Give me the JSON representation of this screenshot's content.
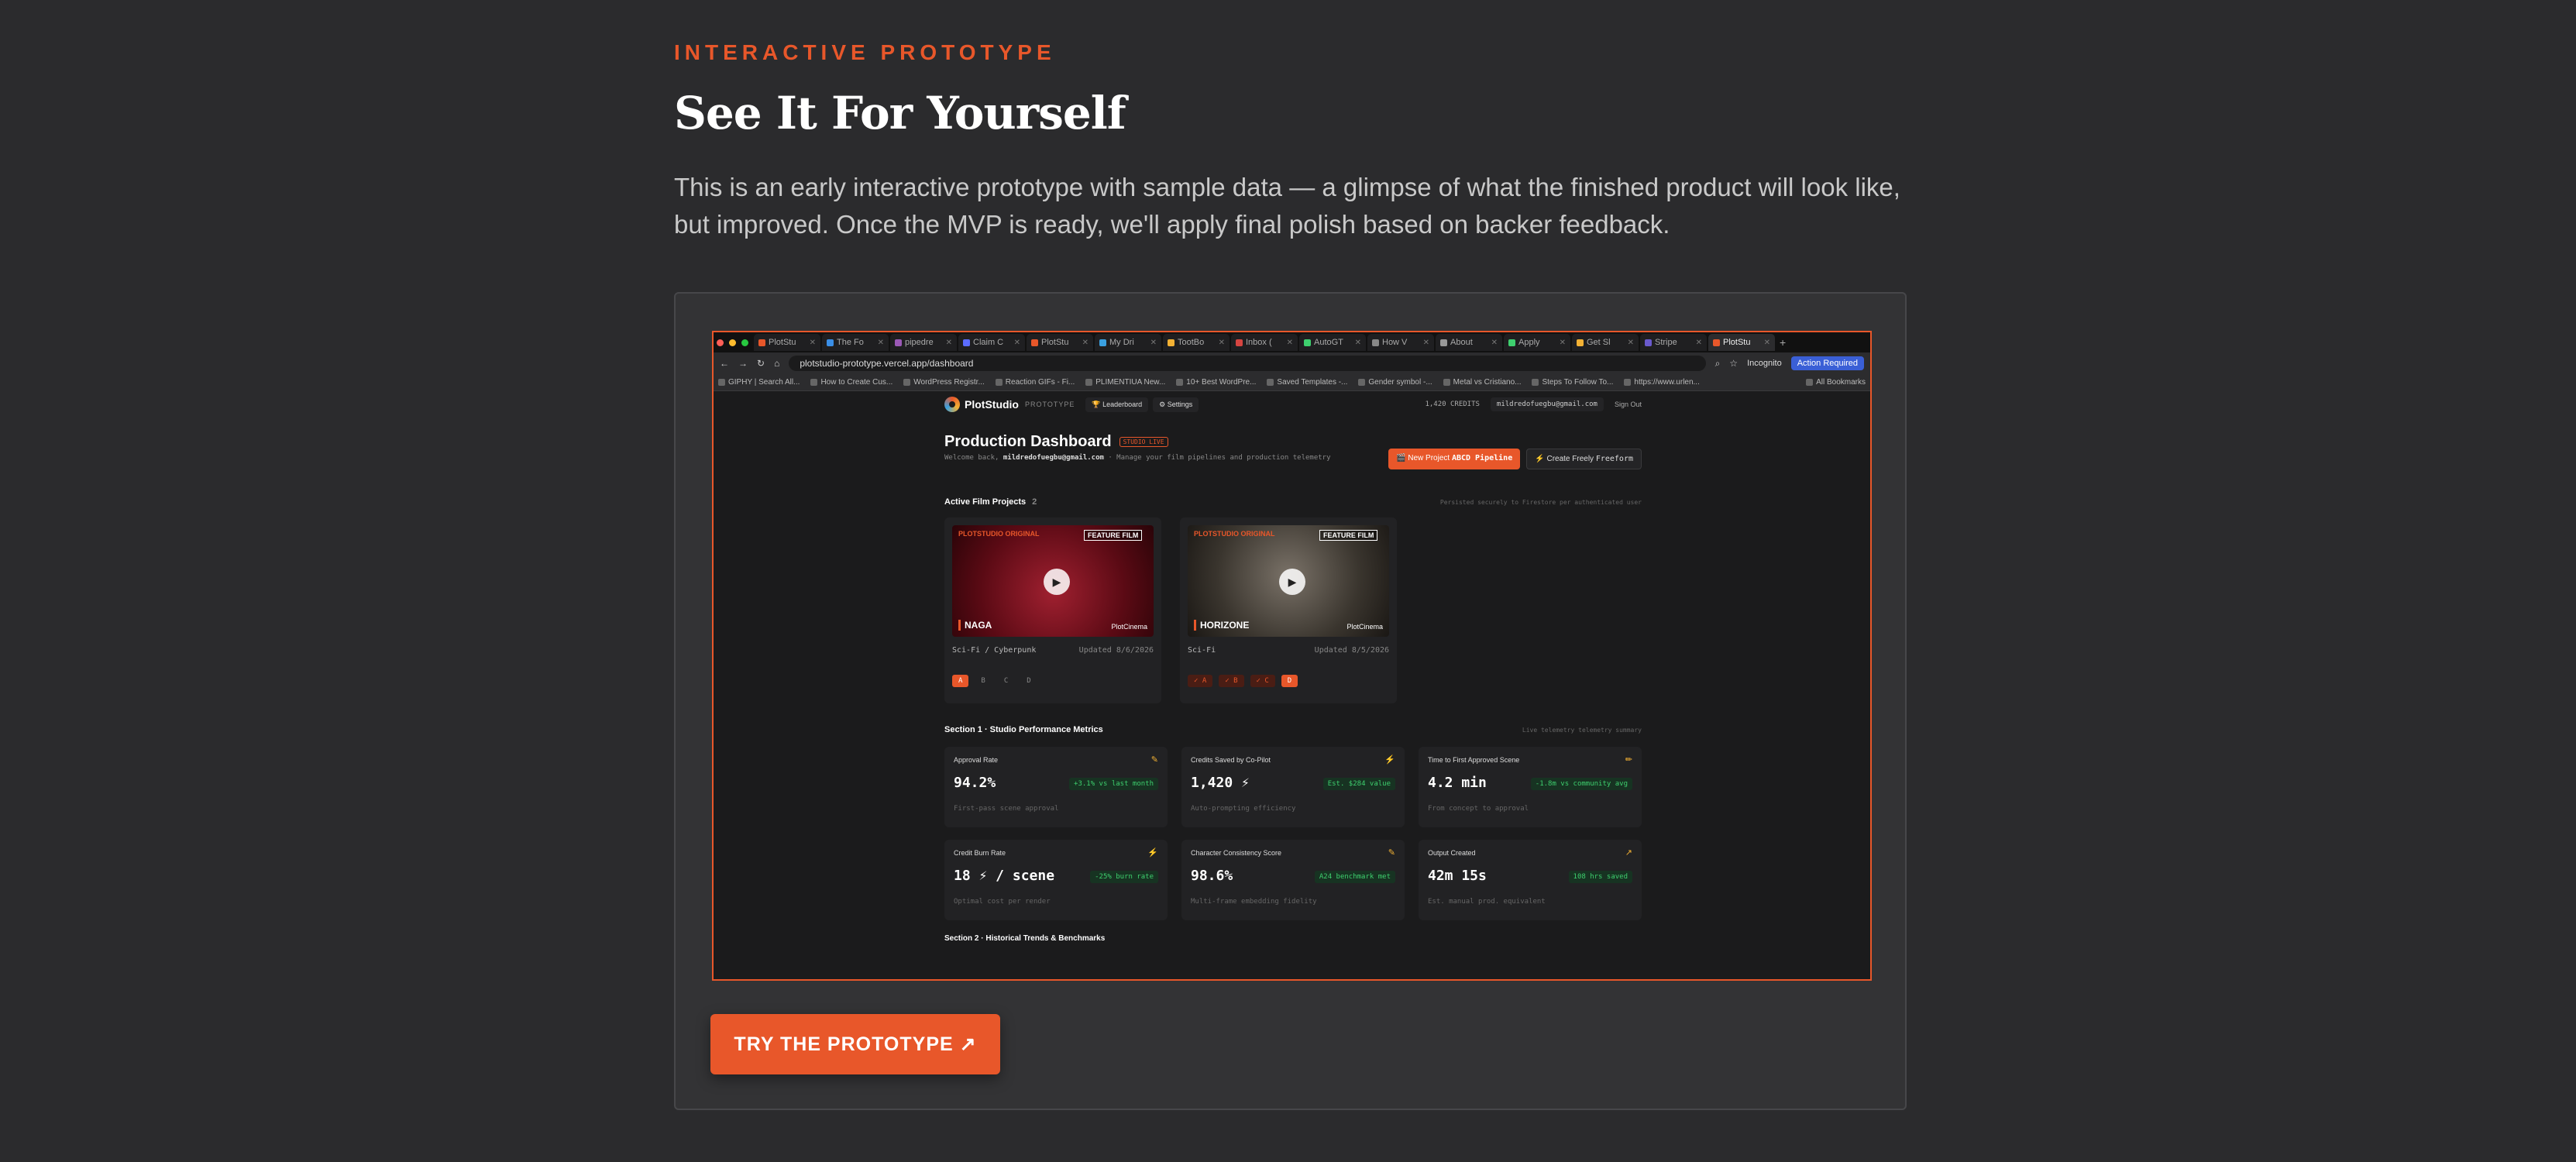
{
  "intro": {
    "eyebrow": "INTERACTIVE PROTOTYPE",
    "headline": "See It For Yourself",
    "lead": "This is an early interactive prototype with sample data — a glimpse of what the finished product will look like, but improved. Once the MVP is ready, we'll apply final polish based on backer feedback."
  },
  "browser": {
    "tabs": [
      "PlotStu",
      "The Fo",
      "pipedre",
      "Claim C",
      "PlotStu",
      "My Dri",
      "TootBo",
      "Inbox (",
      "AutoGT",
      "How V",
      "About",
      "Apply",
      "Get Sl",
      "Stripe",
      "PlotStu"
    ],
    "url": "plotstudio-prototype.vercel.app/dashboard",
    "incognito": "Incognito",
    "action_required": "Action Required",
    "bookmarks": [
      "GIPHY | Search All...",
      "How to Create Cus...",
      "WordPress Registr...",
      "Reaction GIFs - Fi...",
      "PLIMENTIUA New...",
      "10+ Best WordPre...",
      "Saved Templates -...",
      "Gender symbol -...",
      "Metal vs Cristiano...",
      "Steps To Follow To...",
      "https://www.urlen..."
    ],
    "all_bookmarks": "All Bookmarks"
  },
  "app": {
    "brand": "PlotStudio",
    "brand_tag": "PROTOTYPE",
    "nav_leaderboard": "Leaderboard",
    "nav_settings": "Settings",
    "credits": "1,420 CREDITS",
    "email": "mildredofuegbu@gmail.com",
    "sign_out": "Sign Out",
    "title": "Production Dashboard",
    "studio_badge": "STUDIO LIVE",
    "welcome_prefix": "Welcome back,",
    "welcome_email": "mildredofuegbu@gmail.com",
    "welcome_suffix": "· Manage your film pipelines and production telemetry",
    "new_project": "New Project",
    "pipeline": "ABCD Pipeline",
    "create_freely": "Create Freely",
    "freeform": "Freeform",
    "active_title": "Active Film Projects",
    "active_count": "2",
    "persist_note": "Persisted securely to Firestore per authenticated user",
    "projects": [
      {
        "tag": "PLOTSTUDIO ORIGINAL",
        "type": "FEATURE FILM",
        "name": "NAGA",
        "studio": "PlotCinema",
        "genre": "Sci-Fi / Cyberpunk",
        "updated": "Updated 8/6/2026",
        "steps": [
          "A",
          "B",
          "C",
          "D"
        ]
      },
      {
        "tag": "PLOTSTUDIO ORIGINAL",
        "type": "FEATURE FILM",
        "name": "HORIZONE",
        "studio": "PlotCinema",
        "genre": "Sci-Fi",
        "updated": "Updated 8/5/2026",
        "steps": [
          "✓ A",
          "✓ B",
          "✓ C",
          "D"
        ]
      }
    ],
    "section1_title": "Section 1 · Studio Performance Metrics",
    "section1_note": "Live telemetry telemetry summary",
    "metrics": [
      {
        "label": "Approval Rate",
        "value": "94.2%",
        "badge": "+3.1% vs last month",
        "sub": "First-pass scene approval",
        "icon": "✎"
      },
      {
        "label": "Credits Saved by Co-Pilot",
        "value": "1,420 ⚡",
        "badge": "Est. $284 value",
        "sub": "Auto-prompting efficiency",
        "icon": "⚡"
      },
      {
        "label": "Time to First Approved Scene",
        "value": "4.2 min",
        "badge": "-1.8m vs community avg",
        "sub": "From concept to approval",
        "icon": "✏"
      },
      {
        "label": "Credit Burn Rate",
        "value": "18 ⚡ / scene",
        "badge": "-25% burn rate",
        "sub": "Optimal cost per render",
        "icon": "⚡"
      },
      {
        "label": "Character Consistency Score",
        "value": "98.6%",
        "badge": "A24 benchmark met",
        "sub": "Multi-frame embedding fidelity",
        "icon": "✎"
      },
      {
        "label": "Output Created",
        "value": "42m 15s",
        "badge": "108 hrs saved",
        "sub": "Est. manual prod. equivalent",
        "icon": "↗"
      }
    ],
    "section2_title": "Section 2 · Historical Trends & Benchmarks"
  },
  "cta": "TRY THE PROTOTYPE ↗"
}
